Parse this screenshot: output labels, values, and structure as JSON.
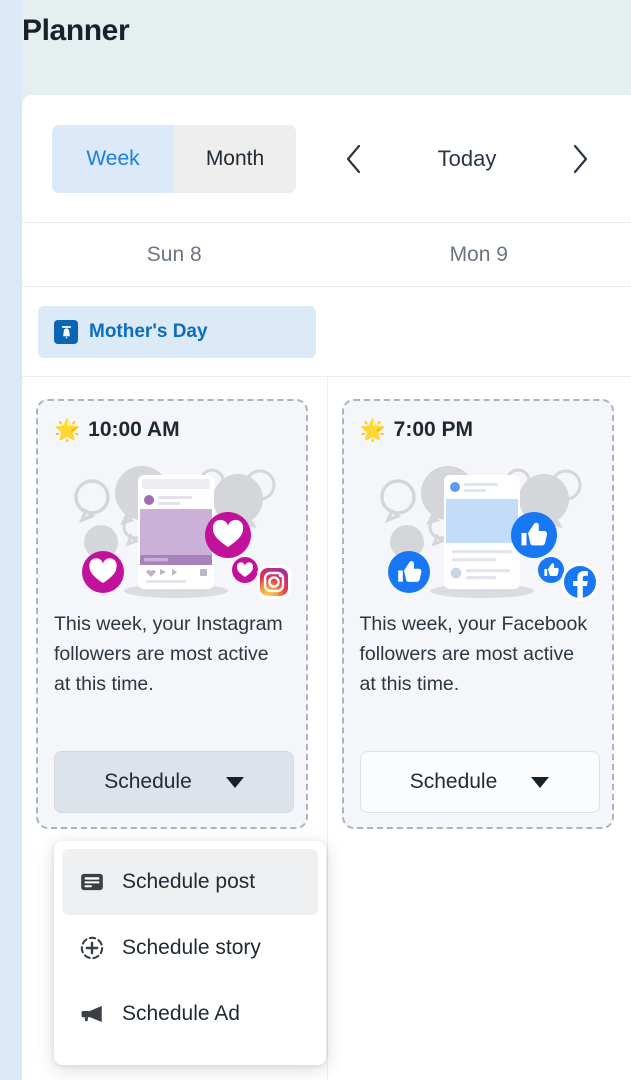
{
  "page_title": "Planner",
  "toolbar": {
    "view_toggle": [
      {
        "label": "Week",
        "state": "active"
      },
      {
        "label": "Month",
        "state": "inactive"
      }
    ],
    "prev_icon": "chevron-left-icon",
    "today_label": "Today",
    "next_icon": "chevron-right-icon"
  },
  "day_headers": [
    {
      "label": "Sun 8"
    },
    {
      "label": "Mon 9"
    }
  ],
  "all_day_event": {
    "label": "Mother's Day",
    "icon": "gift-bag-icon",
    "chip_bg": "#dceaf7",
    "text_color": "#0b6ebc"
  },
  "columns": [
    {
      "day": "Sun 8",
      "card": {
        "star_icon": "🌟",
        "time": "10:00 AM",
        "network": "instagram",
        "illustration": "instagram-engagement-illustration",
        "text": "This week, your Instagram followers are most active at this time.",
        "button_label": "Schedule",
        "button_state": "pressed",
        "caret_icon": "caret-down-icon"
      }
    },
    {
      "day": "Mon 9",
      "card": {
        "star_icon": "🌟",
        "time": "7:00 PM",
        "network": "facebook",
        "illustration": "facebook-engagement-illustration",
        "text": "This week, your Facebook followers are most active at this time.",
        "button_label": "Schedule",
        "button_state": "normal",
        "caret_icon": "caret-down-icon"
      }
    }
  ],
  "schedule_menu": {
    "items": [
      {
        "label": "Schedule post",
        "icon": "card-post-icon",
        "highlighted": true
      },
      {
        "label": "Schedule story",
        "icon": "plus-circle-dashed-icon",
        "highlighted": false
      },
      {
        "label": "Schedule Ad",
        "icon": "megaphone-icon",
        "highlighted": false
      }
    ]
  },
  "colors": {
    "page_bg": "#e6f0f0",
    "rail": "#dbe9f8",
    "accent_blue": "#1a7fe0",
    "instagram_magenta": "#c2119b",
    "facebook_blue": "#1877f2",
    "card_bg": "#f4f6f9",
    "card_border": "#aab4c0"
  }
}
